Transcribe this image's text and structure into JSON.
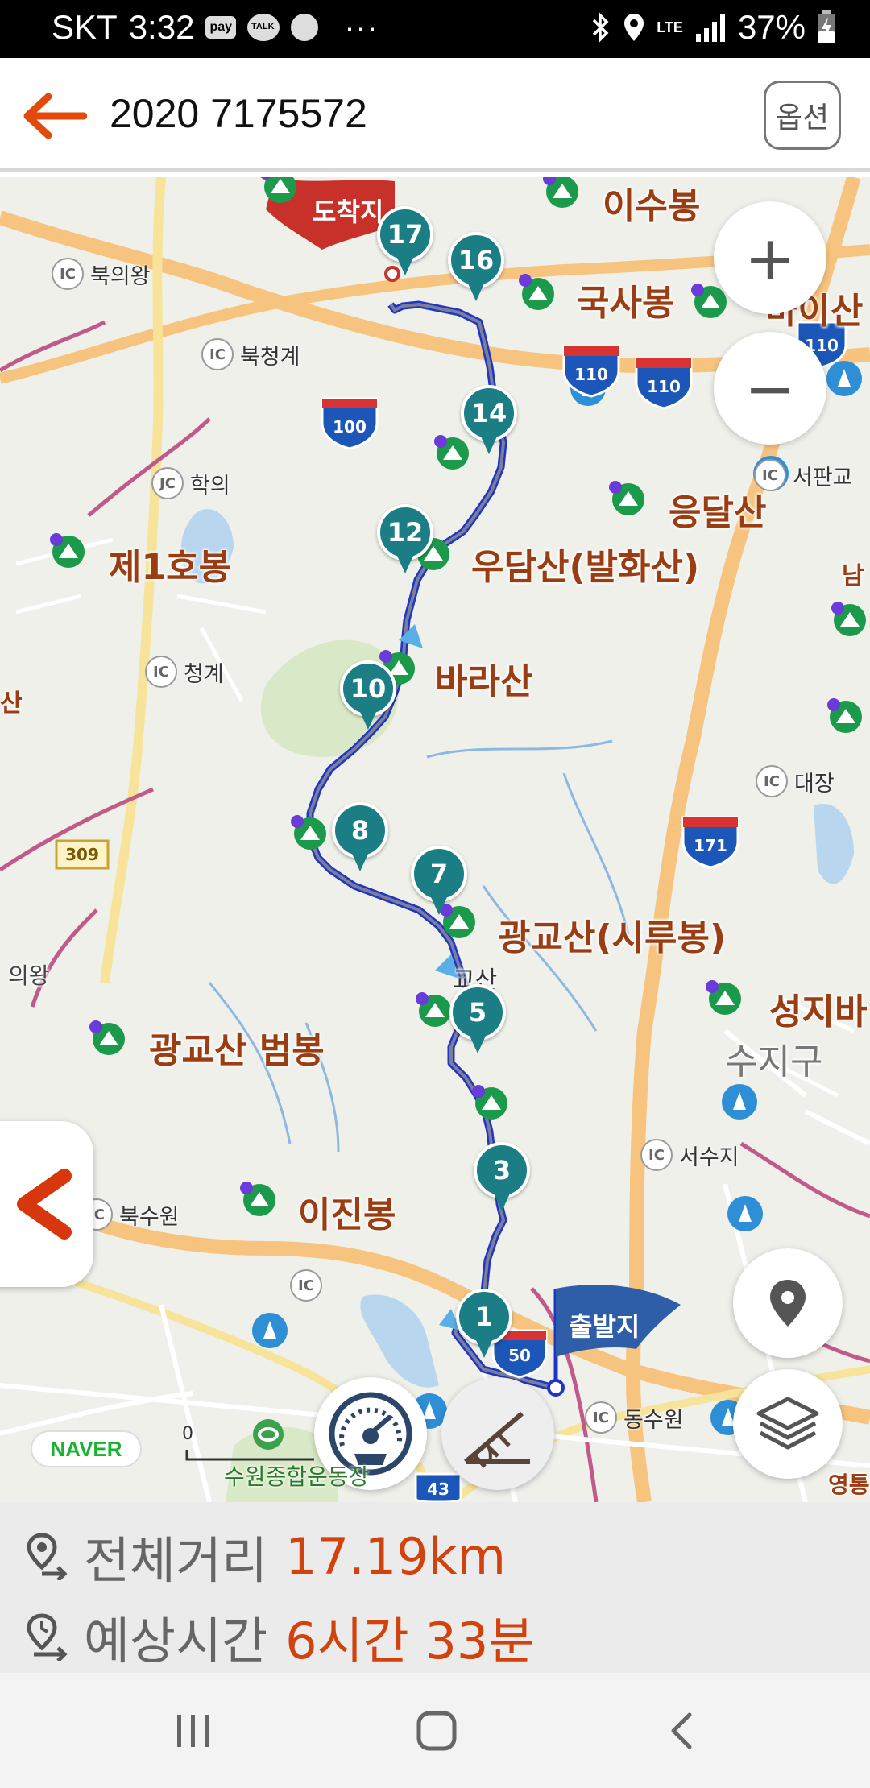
{
  "status_bar": {
    "carrier": "SKT",
    "time": "3:32",
    "pay_badge": "pay",
    "talk_badge": "TALK",
    "more": "···",
    "network": "LTE",
    "battery": "37%"
  },
  "header": {
    "title": "2020 7175572",
    "options_label": "옵션"
  },
  "map": {
    "route_color": "#1f35c8",
    "marker_color": "#1c7e85",
    "start_label": "출발지",
    "end_label": "도착지",
    "markers": [
      "1",
      "3",
      "5",
      "7",
      "8",
      "10",
      "12",
      "14",
      "16",
      "17"
    ],
    "peaks": {
      "isubong": "이수봉",
      "guksabong": "국사봉",
      "eungdalsan": "응달산",
      "udamsan": "우담산(발화산)",
      "je1hobong": "제1호봉",
      "barasan": "바라산",
      "gwanggyosan": "광교산(시루봉)",
      "gwanggyosan_short": "교산",
      "beombong": "광교산 범봉",
      "ijinbong": "이진봉",
      "seongjibong": "성지바",
      "right_edge_1": "남",
      "left_edge_1": "산",
      "top_right_partial": "바이산"
    },
    "districts": {
      "suji": "수지구",
      "uiwang": "의왕",
      "yeongtong": "영통"
    },
    "interchanges": {
      "bukuiwang": "북의왕",
      "bukcheonggye": "북청계",
      "hakui": "학의",
      "cheonggye": "청계",
      "seopangyo": "서판교",
      "daejang": "대장",
      "seosuji": "서수지",
      "buksuwon": "북수원",
      "dongsuwon": "동수원",
      "ic": "IC",
      "jc": "JC"
    },
    "road_shields": [
      "100",
      "110",
      "110",
      "110",
      "171",
      "50",
      "43",
      "309"
    ],
    "poi": "수원종합운동장",
    "scale_zero": "0",
    "naver_logo": "NAVER",
    "zoom_in": "+",
    "zoom_out": "−"
  },
  "summary": {
    "distance_label": "전체거리",
    "distance_value": "17.19km",
    "time_label": "예상시간",
    "time_value": "6시간 33분"
  },
  "nav_bar": {
    "recent_label": "recent-apps",
    "home_label": "home",
    "back_label": "back"
  }
}
